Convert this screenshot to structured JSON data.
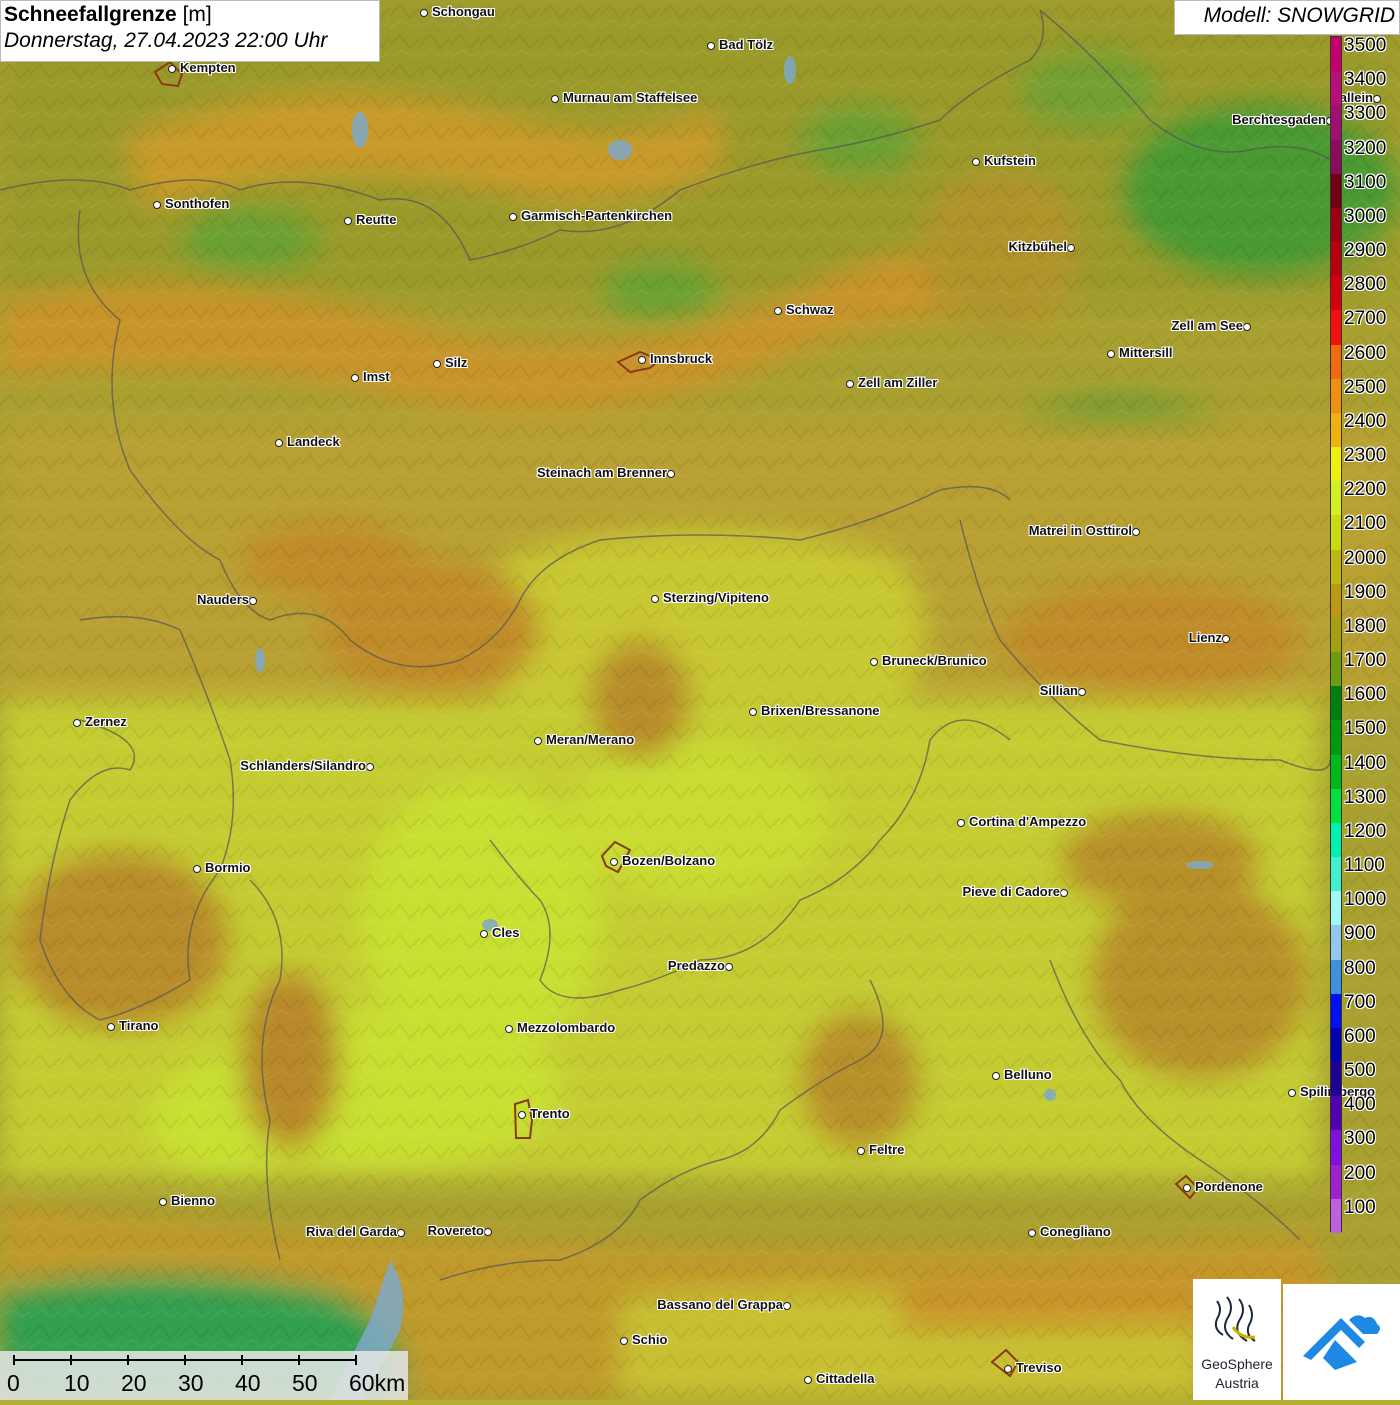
{
  "title": {
    "name": "Schneefallgrenze",
    "unit": "[m]",
    "datetime": "Donnerstag, 27.04.2023 22:00 Uhr"
  },
  "model": "Modell: SNOWGRID",
  "legend": {
    "levels": [
      3500,
      3400,
      3300,
      3200,
      3100,
      3000,
      2900,
      2800,
      2700,
      2600,
      2500,
      2400,
      2300,
      2200,
      2100,
      2000,
      1900,
      1800,
      1700,
      1600,
      1500,
      1400,
      1300,
      1200,
      1100,
      1000,
      900,
      800,
      700,
      600,
      500,
      400,
      300,
      200,
      100
    ],
    "colors": [
      "#c5006e",
      "#b70e7a",
      "#a01070",
      "#8a0c5a",
      "#6e0010",
      "#9a0010",
      "#b80010",
      "#d40010",
      "#f01010",
      "#f06a10",
      "#f09010",
      "#f0b010",
      "#f0f010",
      "#d0f020",
      "#c8dc10",
      "#bcb810",
      "#bc9a10",
      "#a4a010",
      "#6e9c10",
      "#008010",
      "#009a10",
      "#00b81a",
      "#00e040",
      "#00f0b0",
      "#40f0d0",
      "#a0f8f8",
      "#90c8f0",
      "#4090e0",
      "#0010f0",
      "#0000b0",
      "#200090",
      "#5000b0",
      "#8010e0",
      "#a020d0",
      "#c060e0"
    ]
  },
  "scale": {
    "labels": [
      "0",
      "10",
      "20",
      "30",
      "40",
      "50",
      "60km"
    ]
  },
  "logo": {
    "line1": "GeoSphere",
    "line2": "Austria"
  },
  "cities": [
    {
      "name": "Schongau"
    },
    {
      "name": "Bad Tölz"
    },
    {
      "name": "Kempten"
    },
    {
      "name": "Murnau am Staffelsee"
    },
    {
      "name": "Hallein"
    },
    {
      "name": "Berchtesgaden"
    },
    {
      "name": "Kufstein"
    },
    {
      "name": "Sonthofen"
    },
    {
      "name": "Reutte"
    },
    {
      "name": "Garmisch-Partenkirchen"
    },
    {
      "name": "Kitzbühel"
    },
    {
      "name": "Schwaz"
    },
    {
      "name": "Zell am See"
    },
    {
      "name": "Mittersill"
    },
    {
      "name": "Innsbruck"
    },
    {
      "name": "Silz"
    },
    {
      "name": "Imst"
    },
    {
      "name": "Zell am Ziller"
    },
    {
      "name": "Landeck"
    },
    {
      "name": "Steinach am Brenner"
    },
    {
      "name": "Matrei in Osttirol"
    },
    {
      "name": "Nauders"
    },
    {
      "name": "Sterzing/Vipiteno"
    },
    {
      "name": "Lienz"
    },
    {
      "name": "Bruneck/Brunico"
    },
    {
      "name": "Sillian"
    },
    {
      "name": "Zernez"
    },
    {
      "name": "Brixen/Bressanone"
    },
    {
      "name": "Meran/Merano"
    },
    {
      "name": "Schlanders/Silandro"
    },
    {
      "name": "Cortina d'Ampezzo"
    },
    {
      "name": "Bozen/Bolzano"
    },
    {
      "name": "Bormio"
    },
    {
      "name": "Pieve di Cadore"
    },
    {
      "name": "Cles"
    },
    {
      "name": "Predazzo"
    },
    {
      "name": "Tirano"
    },
    {
      "name": "Mezzolombardo"
    },
    {
      "name": "Belluno"
    },
    {
      "name": "Spilimbergo"
    },
    {
      "name": "Trento"
    },
    {
      "name": "Feltre"
    },
    {
      "name": "Pordenone"
    },
    {
      "name": "Bienno"
    },
    {
      "name": "Riva del Garda"
    },
    {
      "name": "Rovereto"
    },
    {
      "name": "Conegliano"
    },
    {
      "name": "Bassano del Grappa"
    },
    {
      "name": "Schio"
    },
    {
      "name": "Treviso"
    },
    {
      "name": "Cittadella"
    }
  ]
}
